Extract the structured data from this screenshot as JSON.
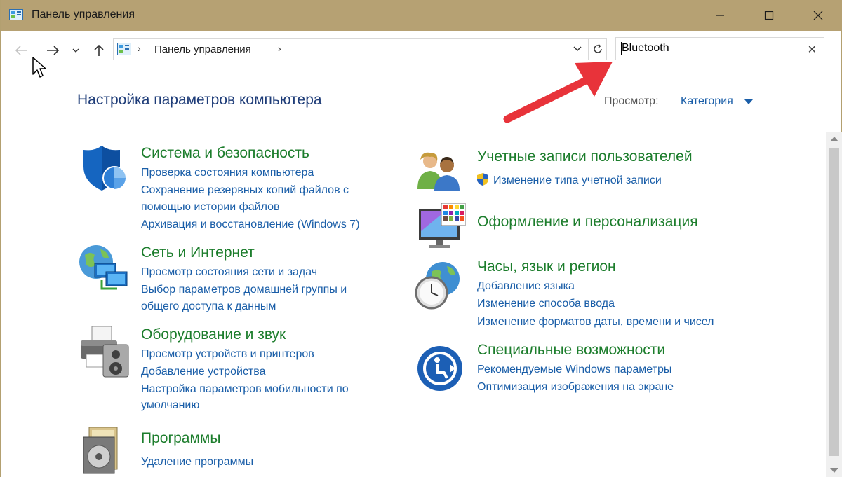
{
  "window": {
    "title": "Панель управления",
    "minimize": "minimize",
    "maximize": "maximize",
    "close": "close"
  },
  "address": {
    "breadcrumb": "Панель управления"
  },
  "search": {
    "value": "Bluetooth"
  },
  "header": {
    "title": "Настройка параметров компьютера",
    "view_label": "Просмотр:",
    "view_value": "Категория"
  },
  "categories": {
    "system": {
      "title": "Система и безопасность",
      "links": [
        "Проверка состояния компьютера",
        "Сохранение резервных копий файлов с",
        "помощью истории файлов",
        "Архивация и восстановление (Windows 7)"
      ]
    },
    "network": {
      "title": "Сеть и Интернет",
      "links": [
        "Просмотр состояния сети и задач",
        "Выбор параметров домашней группы и",
        "общего доступа к данным"
      ]
    },
    "hardware": {
      "title": "Оборудование и звук",
      "links": [
        "Просмотр устройств и принтеров",
        "Добавление устройства",
        "Настройка параметров мобильности по",
        "умолчанию"
      ]
    },
    "programs": {
      "title": "Программы",
      "links": [
        "Удаление программы"
      ]
    },
    "accounts": {
      "title": "Учетные записи пользователей",
      "links": [
        "Изменение типа учетной записи"
      ]
    },
    "appearance": {
      "title": "Оформление и персонализация",
      "links": []
    },
    "clock": {
      "title": "Часы, язык и регион",
      "links": [
        "Добавление языка",
        "Изменение способа ввода",
        "Изменение форматов даты, времени и чисел"
      ]
    },
    "access": {
      "title": "Специальные возможности",
      "links": [
        "Рекомендуемые Windows параметры",
        "Оптимизация изображения на экране"
      ]
    }
  },
  "colors": {
    "titlebar": "#b6a173",
    "category_title": "#1c7d2c",
    "link": "#1a5ea8",
    "heading": "#1e3c78",
    "annotation_arrow": "#e8333a"
  },
  "icons": [
    "control-panel-icon",
    "back-arrow-icon",
    "forward-arrow-icon",
    "recent-dropdown-icon",
    "up-arrow-icon",
    "refresh-icon",
    "clear-search-icon",
    "shield-icon",
    "network-globe-icon",
    "printer-icon",
    "programs-disc-icon",
    "users-icon",
    "uac-shield-icon",
    "monitor-palette-icon",
    "clock-globe-icon",
    "accessibility-icon"
  ]
}
